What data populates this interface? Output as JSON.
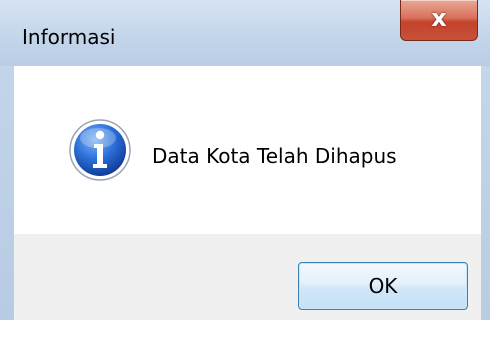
{
  "dialog": {
    "title": "Informasi",
    "close_glyph": "x",
    "message": "Data Kota Telah Dihapus",
    "icon": "information-icon",
    "ok_label": "OK"
  },
  "colors": {
    "content_bg": "#ffffff",
    "footer_bg": "#f0f0f0",
    "close_button": "#c8503a",
    "icon_blue": "#1f5bc4"
  }
}
